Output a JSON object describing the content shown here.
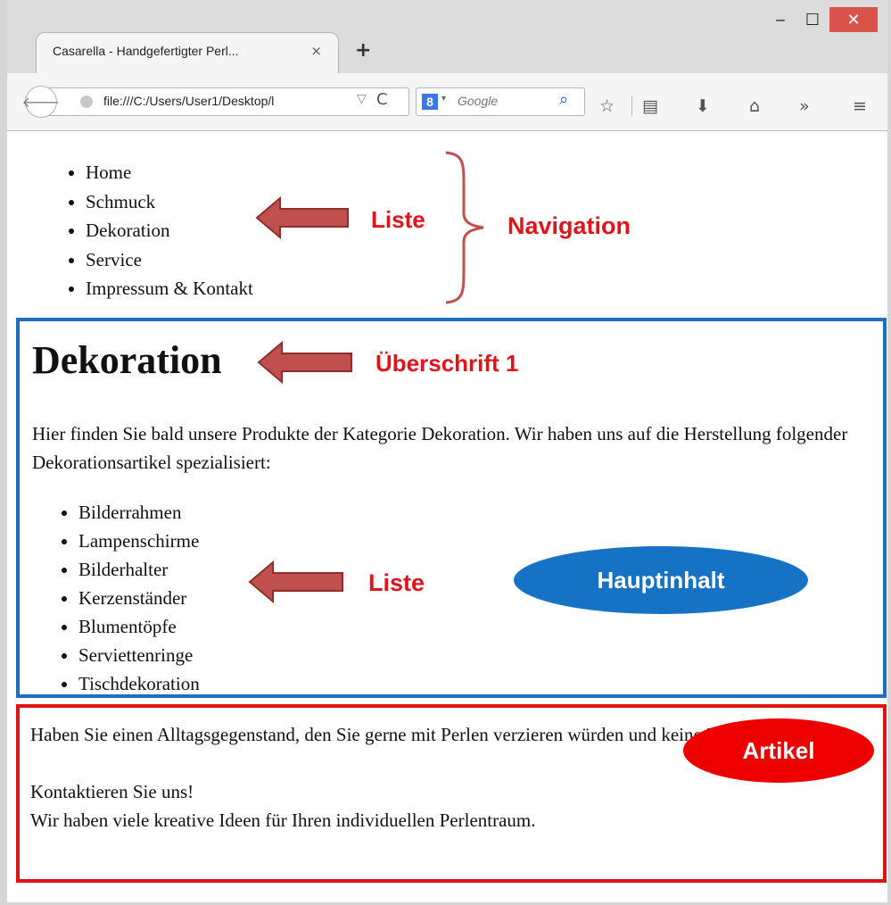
{
  "browser": {
    "tab_title": "Casarella - Handgefertigter Perl...",
    "tab_close": "×",
    "new_tab": "+",
    "window": {
      "minimize": "‒",
      "maximize": "☐",
      "close": "✕"
    },
    "url": "file:///C:/Users/User1/Desktop/l",
    "url_dropdown": "▽",
    "reload": "C",
    "search_engine_letter": "8",
    "search_dropdown": "▾",
    "search_placeholder": "Google",
    "icons": [
      "star-icon",
      "reading-list-icon",
      "download-icon",
      "home-icon",
      "overflow-icon",
      "menu-icon"
    ]
  },
  "page": {
    "nav_items": [
      "Home",
      "Schmuck",
      "Dekoration",
      "Service",
      "Impressum & Kontakt"
    ],
    "heading": "Dekoration",
    "intro": "Hier finden Sie bald unsere Produkte der Kategorie Dekoration. Wir haben uns auf die Herstellung folgender Dekorationsartikel spezialisiert:",
    "products": [
      "Bilderrahmen",
      "Lampenschirme",
      "Bilderhalter",
      "Kerzenständer",
      "Blumentöpfe",
      "Serviettenringe",
      "Tischdekoration"
    ],
    "article_line1": "Haben Sie einen Alltagsgegenstand, den Sie gerne mit Perlen verzieren würden und keine Idee wie?",
    "article_line2": "Kontaktieren Sie uns!",
    "article_line3": "Wir haben viele kreative Ideen für Ihren individuellen Perlentraum."
  },
  "annotations": {
    "liste_nav": "Liste",
    "navigation": "Navigation",
    "ueberschrift": "Überschrift 1",
    "liste_main": "Liste",
    "hauptinhalt": "Hauptinhalt",
    "artikel": "Artikel",
    "colors": {
      "red": "#e0141b",
      "blue": "#1f6fc0",
      "arrow": "#c0504d"
    }
  }
}
